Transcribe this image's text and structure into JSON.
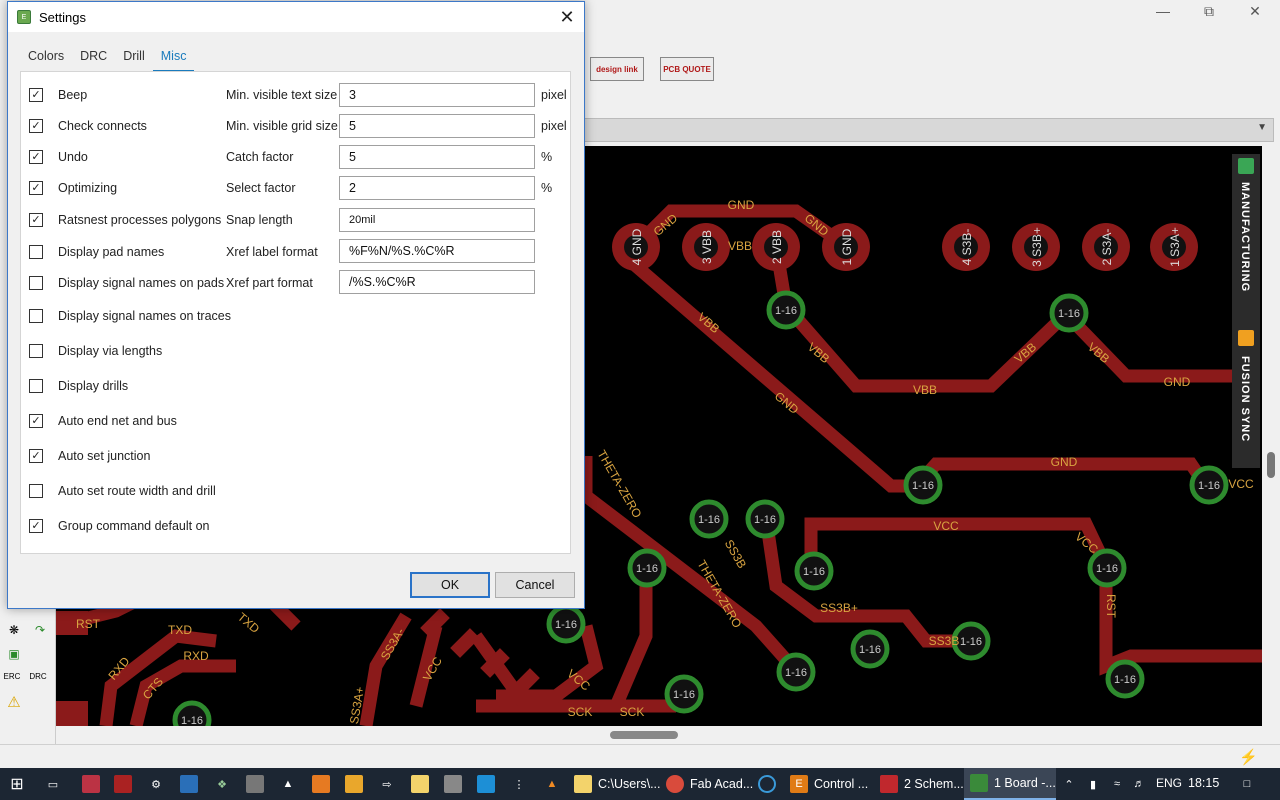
{
  "dialog": {
    "title": "Settings",
    "tabs": [
      {
        "label": "Colors",
        "active": false
      },
      {
        "label": "DRC",
        "active": false
      },
      {
        "label": "Drill",
        "active": false
      },
      {
        "label": "Misc",
        "active": true
      }
    ],
    "checkboxes": [
      {
        "label": "Beep",
        "checked": true
      },
      {
        "label": "Check connects",
        "checked": true
      },
      {
        "label": "Undo",
        "checked": true
      },
      {
        "label": "Optimizing",
        "checked": true
      },
      {
        "label": "Ratsnest processes polygons",
        "checked": true
      },
      {
        "label": "Display pad names",
        "checked": false
      },
      {
        "label": "Display signal names on pads",
        "checked": false
      },
      {
        "label": "Display signal names on traces",
        "checked": false
      },
      {
        "label": "Display via lengths",
        "checked": false
      },
      {
        "label": "Display drills",
        "checked": false
      },
      {
        "label": "Auto end net and bus",
        "checked": true
      },
      {
        "label": "Auto set junction",
        "checked": true
      },
      {
        "label": "Auto set route width and drill",
        "checked": false
      },
      {
        "label": "Group command default on",
        "checked": true
      }
    ],
    "fields": [
      {
        "label": "Min. visible text size",
        "value": "3",
        "unit": "pixel"
      },
      {
        "label": "Min. visible grid size",
        "value": "5",
        "unit": "pixel"
      },
      {
        "label": "Catch factor",
        "value": "5",
        "unit": "%"
      },
      {
        "label": "Select factor",
        "value": "2",
        "unit": "%"
      },
      {
        "label": "Snap length",
        "value": "20mil",
        "unit": ""
      },
      {
        "label": "Xref label format",
        "value": "%F%N/%S.%C%R",
        "unit": ""
      },
      {
        "label": "Xref part format",
        "value": "/%S.%C%R",
        "unit": ""
      }
    ],
    "ok_label": "OK",
    "cancel_label": "Cancel",
    "check_mark": "✓"
  },
  "background": {
    "toolbar_logos": [
      "design link",
      "PCB QUOTE"
    ],
    "side_panel": [
      "MANUFACTURING",
      "FUSION SYNC"
    ],
    "left_tools": [
      "ERC",
      "DRC"
    ],
    "pcb_labels": [
      "GND",
      "GND",
      "GND",
      "VBB",
      "VBB",
      "VBB",
      "VBB",
      "VBB",
      "VBB",
      "GND",
      "GND",
      "GND",
      "VCC",
      "VCC",
      "VCC",
      "SS3B",
      "SS3B+",
      "SS3B",
      "THETA-ZERO",
      "THETA-ZERO",
      "RST",
      "TXD",
      "RXD",
      "CTS",
      "SCK",
      "SCK",
      "SS3A-",
      "SS3A+",
      "VCC",
      "VCC",
      "RST",
      "TXD",
      "RXD"
    ],
    "pads": [
      {
        "num": "4",
        "net": "GND"
      },
      {
        "num": "3",
        "net": "VBB"
      },
      {
        "num": "2",
        "net": "VBB"
      },
      {
        "num": "1",
        "net": "GND"
      },
      {
        "num": "4",
        "net": "S3B-"
      },
      {
        "num": "3",
        "net": "S3B+"
      },
      {
        "num": "2",
        "net": "S3A-"
      },
      {
        "num": "1",
        "net": "S3A+"
      }
    ],
    "via_label": "1-16",
    "colors": {
      "trace": "#8b1a1a",
      "via": "#2e8b2e",
      "label": "#d9a441",
      "board": "#000000"
    }
  },
  "taskbar": {
    "items": [
      "C:\\Users\\...",
      "Fab Acad...",
      "Control ...",
      "2 Schem...",
      "1 Board -..."
    ],
    "lang": "ENG",
    "time": "18:15"
  }
}
